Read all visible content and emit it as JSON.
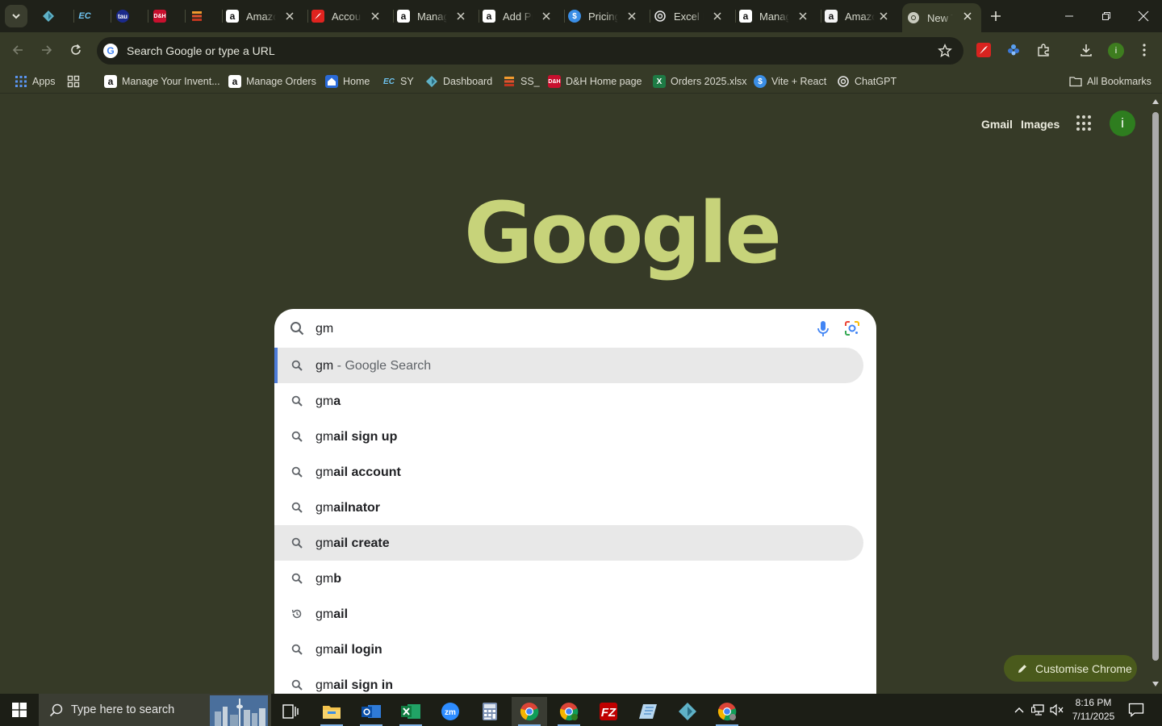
{
  "tabs": [
    {
      "title": "",
      "favicon": "teal-diamond"
    },
    {
      "title": "",
      "favicon": "ec"
    },
    {
      "title": "",
      "favicon": "tau"
    },
    {
      "title": "",
      "favicon": "dh"
    },
    {
      "title": "",
      "favicon": "ss-stack"
    },
    {
      "title": "Amazon",
      "favicon": "amazon"
    },
    {
      "title": "Account",
      "favicon": "acrobat"
    },
    {
      "title": "Manage",
      "favicon": "amazon"
    },
    {
      "title": "Add Product",
      "favicon": "amazon"
    },
    {
      "title": "Pricing",
      "favicon": "dollar"
    },
    {
      "title": "Excel F",
      "favicon": "openai"
    },
    {
      "title": "Manage",
      "favicon": "amazon"
    },
    {
      "title": "Amazon",
      "favicon": "amazon-light"
    },
    {
      "title": "New Tab",
      "favicon": "chrome"
    }
  ],
  "omnibox": {
    "placeholder": "Search Google or type a URL"
  },
  "profile": {
    "initial": "i",
    "color": "#2e7d1f"
  },
  "bookmarks": [
    {
      "label": "Apps",
      "icon": "apps-grid-icon"
    },
    {
      "label": "",
      "icon": "tab-groups-icon"
    },
    {
      "label": "Manage Your Invent...",
      "icon": "amazon"
    },
    {
      "label": "Manage Orders",
      "icon": "amazon"
    },
    {
      "label": "Home",
      "icon": "home"
    },
    {
      "label": "SY",
      "icon": "ec"
    },
    {
      "label": "Dashboard",
      "icon": "teal-diamond"
    },
    {
      "label": "SS_",
      "icon": "ss-stack"
    },
    {
      "label": "D&H Home page",
      "icon": "dh"
    },
    {
      "label": "Orders 2025.xlsx",
      "icon": "excel"
    },
    {
      "label": "Vite + React",
      "icon": "dollar"
    },
    {
      "label": "ChatGPT",
      "icon": "openai"
    },
    {
      "label": "All Bookmarks",
      "icon": "folder-icon"
    }
  ],
  "ntp": {
    "gmail_link": "Gmail",
    "images_link": "Images",
    "logo_text": "Google",
    "customise_label": "Customise Chrome"
  },
  "search": {
    "query": "gm",
    "suggestions": [
      {
        "typed": "gm",
        "rest": "",
        "suffix": " - Google Search",
        "icon": "search",
        "state": "selected"
      },
      {
        "typed": "gm",
        "rest": "a",
        "suffix": "",
        "icon": "search",
        "state": ""
      },
      {
        "typed": "gm",
        "rest": "ail sign up",
        "suffix": "",
        "icon": "search",
        "state": ""
      },
      {
        "typed": "gm",
        "rest": "ail account",
        "suffix": "",
        "icon": "search",
        "state": ""
      },
      {
        "typed": "gm",
        "rest": "ailnator",
        "suffix": "",
        "icon": "search",
        "state": ""
      },
      {
        "typed": "gm",
        "rest": "ail create",
        "suffix": "",
        "icon": "search",
        "state": "hover"
      },
      {
        "typed": "gm",
        "rest": "b",
        "suffix": "",
        "icon": "search",
        "state": ""
      },
      {
        "typed": "gm",
        "rest": "ail",
        "suffix": "",
        "icon": "history",
        "state": ""
      },
      {
        "typed": "gm",
        "rest": "ail login",
        "suffix": "",
        "icon": "search",
        "state": ""
      },
      {
        "typed": "gm",
        "rest": "ail sign in",
        "suffix": "",
        "icon": "search",
        "state": ""
      }
    ]
  },
  "taskbar": {
    "search_placeholder": "Type here to search",
    "time": "8:16 PM",
    "date": "7/11/2025"
  },
  "colors": {
    "ntp_background": "#363a27",
    "logo": "#c7d37a",
    "accent_blue": "#4c7bd8"
  }
}
